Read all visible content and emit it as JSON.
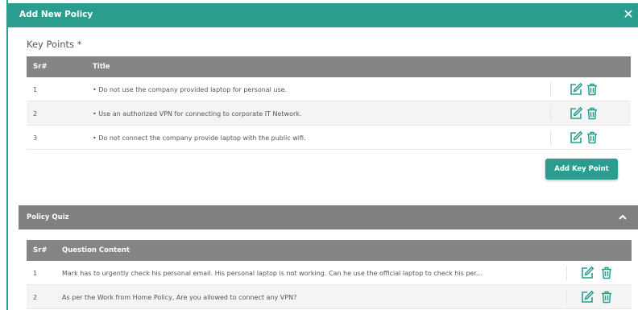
{
  "modal": {
    "title": "Add New Policy"
  },
  "key_points": {
    "label": "Key Points *",
    "columns": {
      "sr": "Sr#",
      "title": "Title"
    },
    "rows": [
      {
        "sr": "1",
        "title": "• Do not use the company provided laptop for personal use."
      },
      {
        "sr": "2",
        "title": "• Use an authorized VPN for connecting to corporate IT Network."
      },
      {
        "sr": "3",
        "title": "• Do not connect the company provide laptop with the public wifi."
      }
    ],
    "add_button": "Add Key Point"
  },
  "policy_quiz": {
    "title": "Policy Quiz",
    "columns": {
      "sr": "Sr#",
      "question": "Question Content"
    },
    "rows": [
      {
        "sr": "1",
        "question": "Mark has to urgently check his personal email. His personal laptop is not working. Can he use the official laptop to check his per..."
      },
      {
        "sr": "2",
        "question": "As per the Work from Home Policy, Are you allowed to connect any VPN?"
      }
    ]
  },
  "colors": {
    "accent": "#2a9d8f",
    "header_gray": "#858585",
    "icon_green": "#2a9d8f"
  },
  "icons": {
    "edit": "edit-icon",
    "delete": "trash-icon",
    "close": "close-icon",
    "collapse": "chevron-up-icon"
  }
}
